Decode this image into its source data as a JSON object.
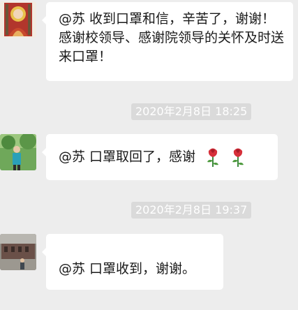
{
  "messages": [
    {
      "text": "@苏 收到口罩和信，辛苦了，谢谢！感谢校领导、感谢院领导的关怀及时送来口罩！",
      "avatar_icon": "monk-portrait-avatar"
    },
    {
      "timestamp": "2020年2月8日 18:25",
      "text": "@苏 口罩取回了，感谢",
      "emoji": [
        "rose-icon",
        "rose-icon"
      ],
      "avatar_icon": "outdoor-person-avatar"
    },
    {
      "timestamp": "2020年2月8日 19:37",
      "text": "@苏 口罩收到，谢谢。",
      "avatar_icon": "building-scene-avatar"
    }
  ],
  "colors": {
    "background": "#ededed",
    "bubble": "#ffffff",
    "timestamp_bg": "#dadada",
    "text": "#1a1a1a"
  }
}
